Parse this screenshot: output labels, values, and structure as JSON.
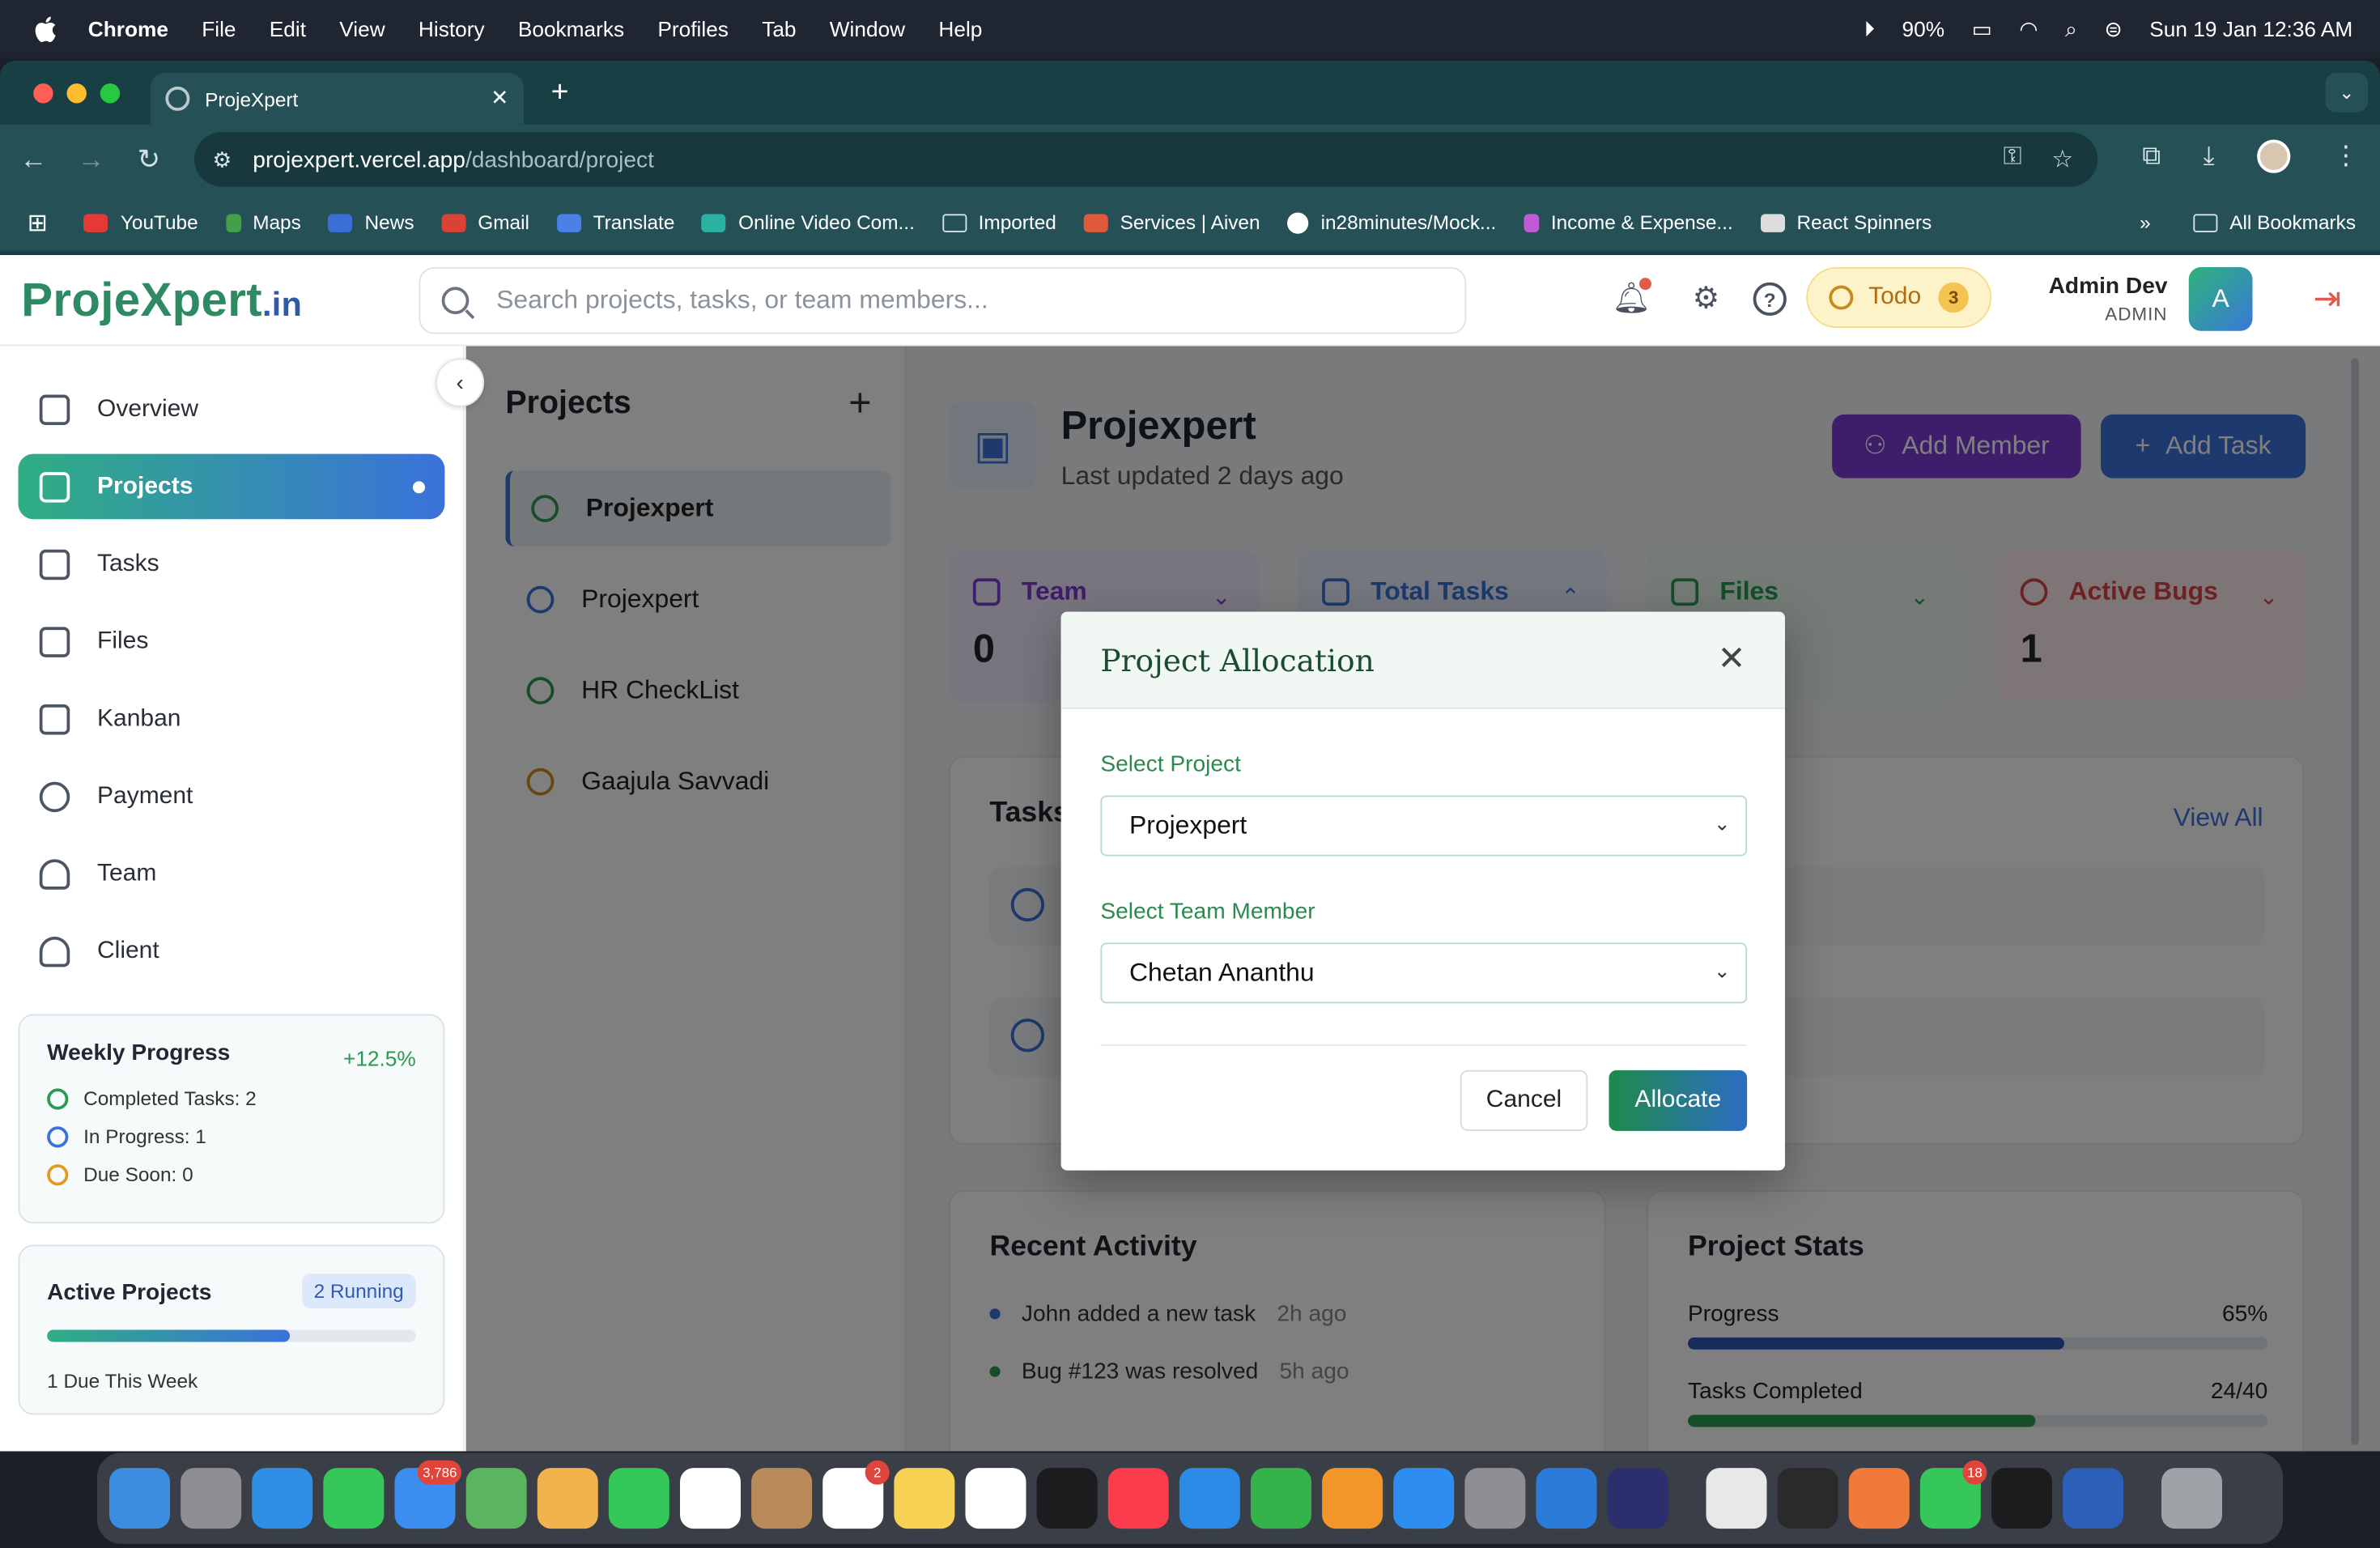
{
  "menubar": {
    "app": "Chrome",
    "items": [
      "File",
      "Edit",
      "View",
      "History",
      "Bookmarks",
      "Profiles",
      "Tab",
      "Window",
      "Help"
    ],
    "battery": "90%",
    "datetime": "Sun 19 Jan  12:36 AM"
  },
  "browser": {
    "tab_title": "ProjeXpert",
    "url_host": "projexpert.vercel.app",
    "url_path": "/dashboard/project",
    "bookmarks": [
      {
        "label": "YouTube",
        "color": "#e53935"
      },
      {
        "label": "Maps",
        "color": "#43a047"
      },
      {
        "label": "News",
        "color": "#3b6fd8"
      },
      {
        "label": "Gmail",
        "color": "#d84333"
      },
      {
        "label": "Translate",
        "color": "#4a80e8"
      },
      {
        "label": "Online Video Com...",
        "color": "#2ab3a0"
      },
      {
        "label": "Imported",
        "color": ""
      },
      {
        "label": "Services | Aiven",
        "color": "#e0593a"
      },
      {
        "label": "in28minutes/Mock...",
        "color": "#ffffff"
      },
      {
        "label": "Income & Expense...",
        "color": "#c25ad4"
      },
      {
        "label": "React Spinners",
        "color": "#dddddd"
      }
    ],
    "all_bookmarks": "All Bookmarks"
  },
  "header": {
    "logo": "ProjeXpert",
    "logo_suffix": ".in",
    "search_placeholder": "Search projects, tasks, or team members...",
    "todo_label": "Todo",
    "todo_count": "3",
    "user_name": "Admin Dev",
    "user_role": "ADMIN",
    "avatar_letter": "A"
  },
  "sidebar": {
    "items": [
      {
        "label": "Overview",
        "icon": "home-icon"
      },
      {
        "label": "Projects",
        "icon": "projects-icon",
        "active": true
      },
      {
        "label": "Tasks",
        "icon": "calendar-icon"
      },
      {
        "label": "Files",
        "icon": "file-icon"
      },
      {
        "label": "Kanban",
        "icon": "kanban-icon"
      },
      {
        "label": "Payment",
        "icon": "payment-icon"
      },
      {
        "label": "Team",
        "icon": "team-icon"
      },
      {
        "label": "Client",
        "icon": "client-icon"
      }
    ],
    "weekly": {
      "title": "Weekly Progress",
      "change": "+12.5%",
      "completed": "Completed Tasks: 2",
      "in_progress": "In Progress: 1",
      "due_soon": "Due Soon: 0"
    },
    "active": {
      "title": "Active Projects",
      "badge": "2 Running",
      "progress": 0.66,
      "footer": "1 Due This Week"
    }
  },
  "projects": {
    "heading": "Projects",
    "list": [
      {
        "name": "Projexpert",
        "status_color": "#2a9a52",
        "selected": true
      },
      {
        "name": "Projexpert",
        "status_color": "#3a72db"
      },
      {
        "name": "HR CheckList",
        "status_color": "#2a9a52"
      },
      {
        "name": "Gaajula Savvadi",
        "status_color": "#d58a1a"
      }
    ]
  },
  "project": {
    "title": "Projexpert",
    "subtitle": "Last updated 2 days ago",
    "add_member": "Add Member",
    "add_task": "Add Task",
    "stats": [
      {
        "label": "Team",
        "value": "0",
        "color": "#7d3dd6",
        "bg": "#f1eafc"
      },
      {
        "label": "Total Tasks",
        "value": "",
        "color": "#3a72db",
        "bg": "#e9f0fc"
      },
      {
        "label": "Files",
        "value": "",
        "color": "#2a9a52",
        "bg": "#e8f6ee"
      },
      {
        "label": "Active Bugs",
        "value": "1",
        "color": "#d9434a",
        "bg": "#fdecec"
      }
    ],
    "tasks_title": "Tasks",
    "view_all": "View All",
    "recent_title": "Recent Activity",
    "activities": [
      {
        "text": "John added a new task",
        "time": "2h ago",
        "color": "#3a72db"
      },
      {
        "text": "Bug #123 was resolved",
        "time": "5h ago",
        "color": "#2a9a52"
      }
    ],
    "stats_title": "Project Stats",
    "progress_label": "Progress",
    "progress_value": "65%",
    "progress": 0.65,
    "tasks_completed_label": "Tasks Completed",
    "tasks_completed_value": "24/40",
    "tasks_completed": 0.6
  },
  "modal": {
    "title": "Project Allocation",
    "project_label": "Select Project",
    "project_value": "Projexpert",
    "member_label": "Select Team Member",
    "member_value": "Chetan Ananthu",
    "cancel": "Cancel",
    "allocate": "Allocate"
  },
  "dock": {
    "apps": [
      {
        "name": "finder",
        "color": "#3a8de0"
      },
      {
        "name": "launchpad",
        "color": "#8e8e93"
      },
      {
        "name": "safari",
        "color": "#2f8ee6"
      },
      {
        "name": "messages",
        "color": "#35c759"
      },
      {
        "name": "mail",
        "color": "#3b8ef0",
        "badge": "3,786"
      },
      {
        "name": "maps",
        "color": "#5ab55e"
      },
      {
        "name": "photos",
        "color": "#f3b34c"
      },
      {
        "name": "facetime",
        "color": "#34c759"
      },
      {
        "name": "calendar",
        "color": "#ffffff"
      },
      {
        "name": "contacts",
        "color": "#b98a5a"
      },
      {
        "name": "reminders",
        "color": "#ffffff",
        "badge": "2"
      },
      {
        "name": "notes",
        "color": "#f7d154"
      },
      {
        "name": "freeform",
        "color": "#ffffff"
      },
      {
        "name": "tv",
        "color": "#1c1c1e"
      },
      {
        "name": "music",
        "color": "#fa3c4c"
      },
      {
        "name": "keynote",
        "color": "#2b8ce8"
      },
      {
        "name": "numbers",
        "color": "#34b34a"
      },
      {
        "name": "pages",
        "color": "#f2962c"
      },
      {
        "name": "app-store",
        "color": "#2d8ef0"
      },
      {
        "name": "system-settings",
        "color": "#8e8e93"
      },
      {
        "name": "vscode",
        "color": "#2b7bd8"
      },
      {
        "name": "eclipse",
        "color": "#2c2f6e"
      },
      {
        "name": "chrome",
        "color": "#e8e8e8"
      },
      {
        "name": "unity",
        "color": "#2a2a2a"
      },
      {
        "name": "sketch",
        "color": "#f07a3a"
      },
      {
        "name": "whatsapp",
        "color": "#35c759",
        "badge": "18"
      },
      {
        "name": "terminal",
        "color": "#1c1c1e"
      },
      {
        "name": "word",
        "color": "#2b5fb8"
      },
      {
        "name": "trash",
        "color": "#9ea3a8"
      }
    ]
  }
}
